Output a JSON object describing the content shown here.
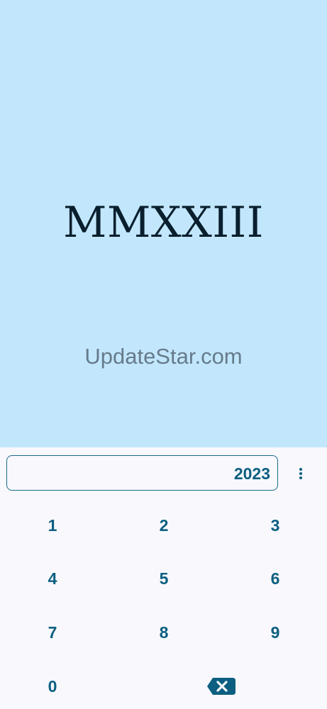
{
  "display": {
    "roman_numeral": "MMXXIII",
    "watermark": "UpdateStar.com"
  },
  "input": {
    "value": "2023"
  },
  "menu": {
    "icon": "more-vert-icon"
  },
  "keypad": {
    "keys": [
      "1",
      "2",
      "3",
      "4",
      "5",
      "6",
      "7",
      "8",
      "9",
      "0"
    ],
    "backspace_icon": "backspace-icon"
  },
  "colors": {
    "display_background": "#c2e7fd",
    "accent": "#0c5f80",
    "numeral_text": "#0a1f2e",
    "watermark_text": "#667b8a",
    "keypad_background": "#f8f8fd"
  }
}
